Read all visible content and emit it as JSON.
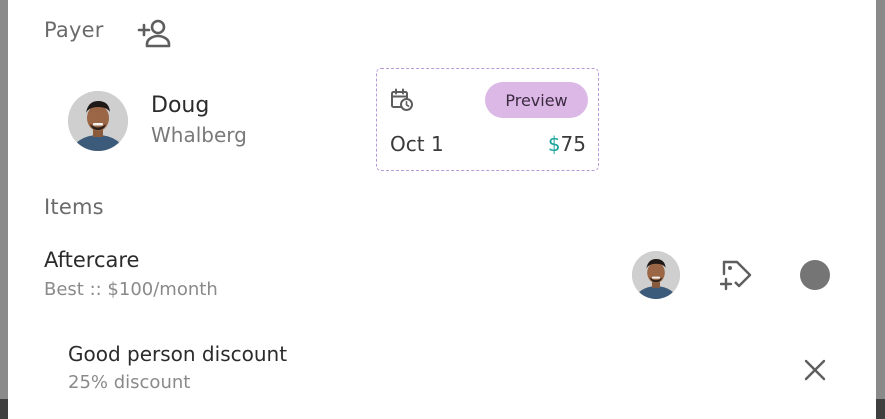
{
  "payer": {
    "section_label": "Payer",
    "add_payer_icon": "person-add-icon",
    "first_name": "Doug",
    "last_name": "Whalberg"
  },
  "payment_card": {
    "schedule_icon": "calendar-clock-icon",
    "preview_label": "Preview",
    "date": "Oct 1",
    "currency_symbol": "$",
    "amount": "75",
    "border_color": "#b99ad8",
    "preview_color": "#dcb8e6",
    "currency_color": "#1aa39a"
  },
  "items": {
    "section_label": "Items",
    "list": [
      {
        "title": "Aftercare",
        "subtitle": "Best :: $100/month",
        "actions": [
          "avatar",
          "add-tag-icon",
          "status-dot"
        ]
      }
    ],
    "discounts": [
      {
        "title": "Good person discount",
        "subtitle": "25% discount",
        "remove_icon": "close-icon"
      }
    ]
  }
}
